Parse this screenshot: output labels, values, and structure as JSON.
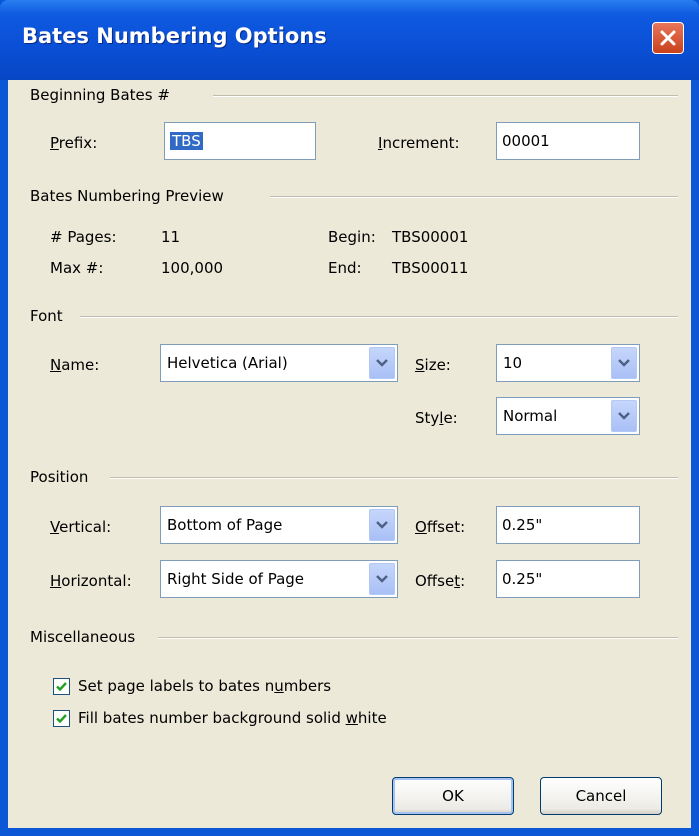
{
  "window": {
    "title": "Bates Numbering Options",
    "close_icon": "close-icon"
  },
  "beginning": {
    "group_label": "Beginning Bates #",
    "prefix_label_pre": "",
    "prefix_label_key": "P",
    "prefix_label_post": "refix:",
    "prefix_value": "TBS",
    "increment_label_pre": "",
    "increment_label_key": "I",
    "increment_label_post": "ncrement:",
    "increment_value": "00001"
  },
  "preview": {
    "group_label": "Bates Numbering Preview",
    "pages_label": "# Pages:",
    "pages_value": "11",
    "max_label": "Max #:",
    "max_value": "100,000",
    "begin_label": "Begin:",
    "begin_value": "TBS00001",
    "end_label": "End:",
    "end_value": "TBS00011"
  },
  "font": {
    "group_label": "Font",
    "name_label_key": "N",
    "name_label_post": "ame:",
    "name_value": "Helvetica (Arial)",
    "size_label_key": "S",
    "size_label_post": "ize:",
    "size_value": "10",
    "style_label_pre": "Sty",
    "style_label_key": "l",
    "style_label_post": "e:",
    "style_value": "Normal"
  },
  "position": {
    "group_label": "Position",
    "vertical_label_key": "V",
    "vertical_label_post": "ertical:",
    "vertical_value": "Bottom of Page",
    "voffset_label_key": "O",
    "voffset_label_post": "ffset:",
    "voffset_value": "0.25\"",
    "horizontal_label_key": "H",
    "horizontal_label_post": "orizontal:",
    "horizontal_value": "Right Side of Page",
    "hoffset_label_pre": "Offse",
    "hoffset_label_key": "t",
    "hoffset_label_post": ":",
    "hoffset_value": "0.25\""
  },
  "misc": {
    "group_label": "Miscellaneous",
    "check1_pre": "Set page labels to bates n",
    "check1_key": "u",
    "check1_post": "mbers",
    "check1_checked": true,
    "check2_pre": "Fill bates number background solid ",
    "check2_key": "w",
    "check2_post": "hite",
    "check2_checked": true
  },
  "buttons": {
    "ok": "OK",
    "cancel": "Cancel"
  }
}
